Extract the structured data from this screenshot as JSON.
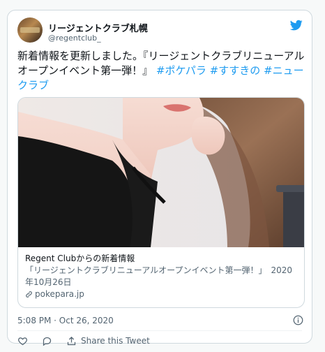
{
  "tweet": {
    "display_name": "リージェントクラブ札幌",
    "handle": "@regentclub_",
    "text_main": "新着情報を更新しました。『リージェントクラブリニューアルオープンイベント第一弾！』",
    "hashtags": [
      "#ポケパラ",
      "#すすきの",
      "#ニュークラブ"
    ],
    "timestamp": "5:08 PM · Oct 26, 2020"
  },
  "link_card": {
    "title": "Regent Clubからの新着情報",
    "description": "「リージェントクラブリニューアルオープンイベント第一弾！」　2020年10月26日",
    "domain": "pokepara.jp"
  },
  "actions": {
    "share_label": "Share this Tweet"
  },
  "colors": {
    "accent": "#1d9bf0",
    "muted": "#536471"
  },
  "icons": [
    "avatar",
    "twitter-bird-icon",
    "link-icon",
    "info-icon",
    "heart-icon",
    "reply-icon",
    "share-icon"
  ]
}
